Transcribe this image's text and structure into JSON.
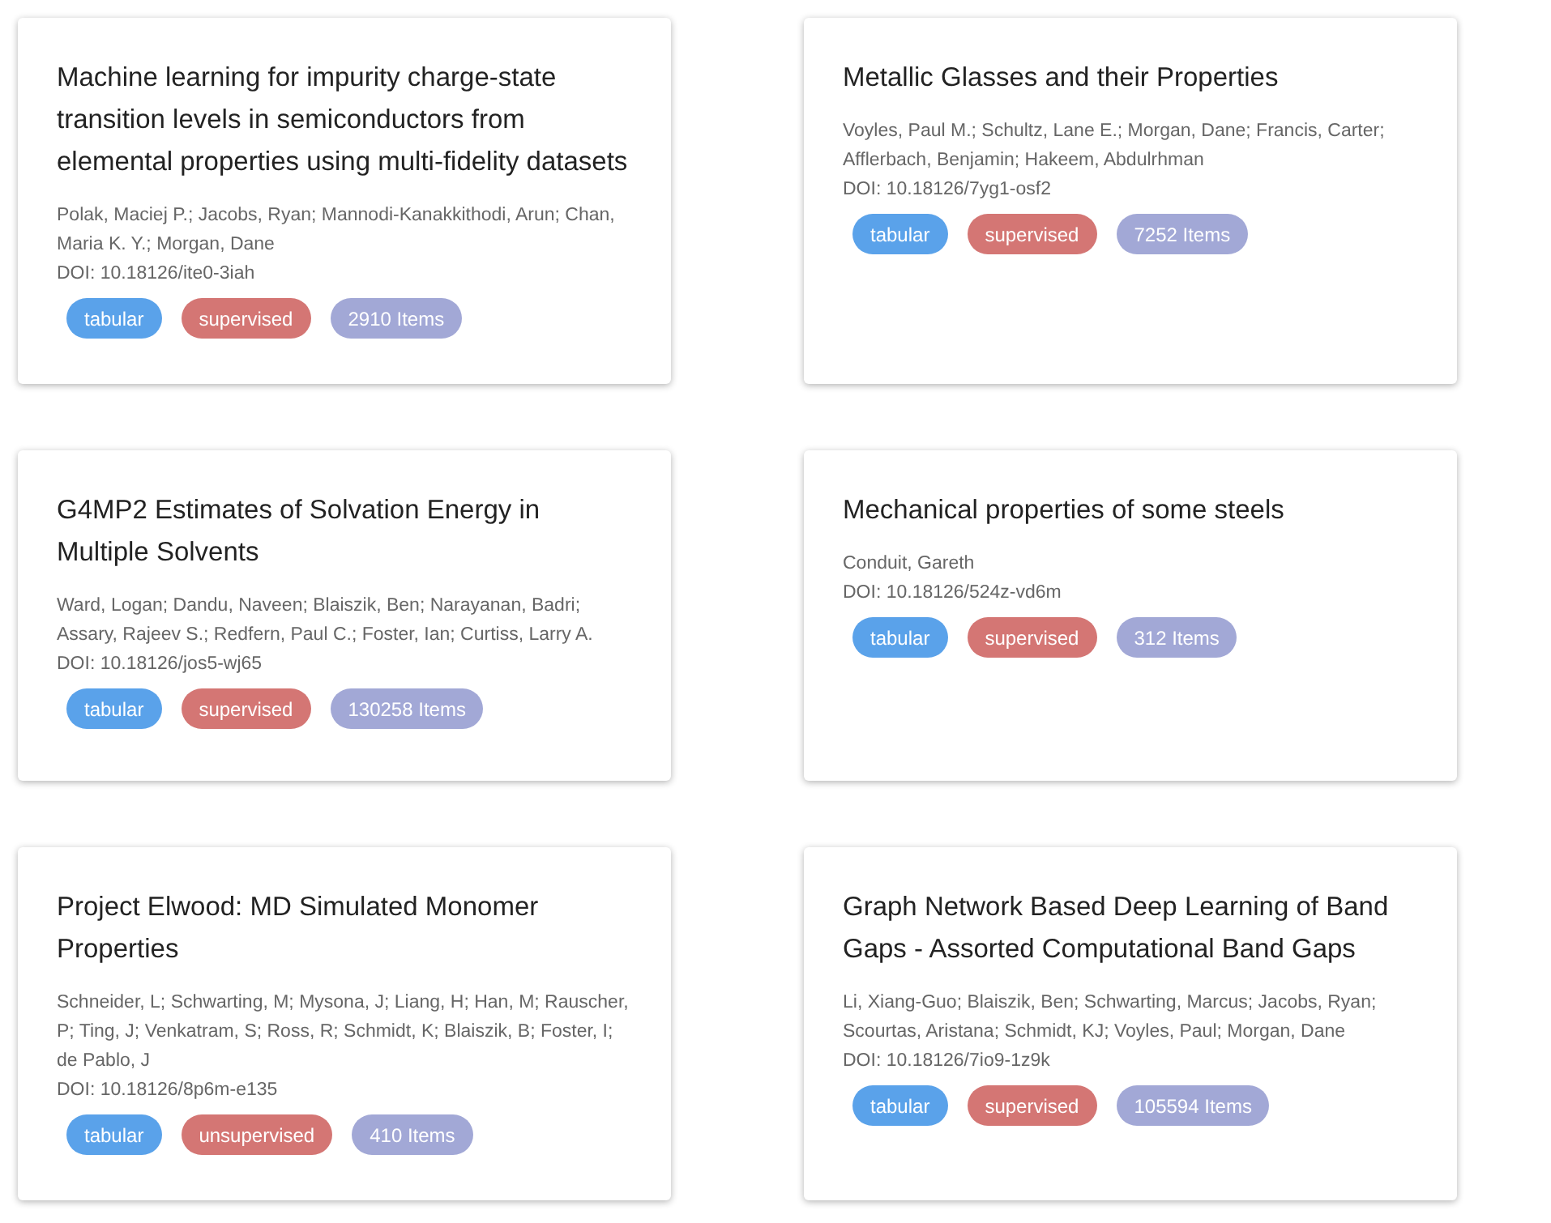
{
  "cards": [
    {
      "title": "Machine learning for impurity charge-state transition levels in semiconductors from elemental properties using multi-fidelity datasets",
      "authors": "Polak, Maciej P.; Jacobs, Ryan; Mannodi-Kanakkithodi, Arun; Chan, Maria K. Y.; Morgan, Dane",
      "doi": "DOI: 10.18126/ite0-3iah",
      "tags": [
        {
          "label": "tabular",
          "color": "#5aa2ea"
        },
        {
          "label": "supervised",
          "color": "#d47674"
        },
        {
          "label": "2910 Items",
          "color": "#a2a8d6"
        }
      ]
    },
    {
      "title": "Metallic Glasses and their Properties",
      "authors": "Voyles, Paul M.; Schultz, Lane E.; Morgan, Dane; Francis, Carter; Afflerbach, Benjamin; Hakeem, Abdulrhman",
      "doi": "DOI: 10.18126/7yg1-osf2",
      "tags": [
        {
          "label": "tabular",
          "color": "#5aa2ea"
        },
        {
          "label": "supervised",
          "color": "#d47674"
        },
        {
          "label": "7252 Items",
          "color": "#a2a8d6"
        }
      ]
    },
    {
      "title": "G4MP2 Estimates of Solvation Energy in Multiple Solvents",
      "authors": "Ward, Logan; Dandu, Naveen; Blaiszik, Ben; Narayanan, Badri; Assary, Rajeev S.; Redfern, Paul C.; Foster, Ian; Curtiss, Larry A.",
      "doi": "DOI: 10.18126/jos5-wj65",
      "tags": [
        {
          "label": "tabular",
          "color": "#5aa2ea"
        },
        {
          "label": "supervised",
          "color": "#d47674"
        },
        {
          "label": "130258 Items",
          "color": "#a2a8d6"
        }
      ]
    },
    {
      "title": "Mechanical properties of some steels",
      "authors": "Conduit, Gareth",
      "doi": "DOI: 10.18126/524z-vd6m",
      "tags": [
        {
          "label": "tabular",
          "color": "#5aa2ea"
        },
        {
          "label": "supervised",
          "color": "#d47674"
        },
        {
          "label": "312 Items",
          "color": "#a2a8d6"
        }
      ]
    },
    {
      "title": "Project Elwood: MD Simulated Monomer Properties",
      "authors": "Schneider, L; Schwarting, M; Mysona, J; Liang, H; Han, M; Rauscher, P; Ting, J; Venkatram, S; Ross, R; Schmidt, K; Blaiszik, B; Foster, I; de Pablo, J",
      "doi": "DOI: 10.18126/8p6m-e135",
      "tags": [
        {
          "label": "tabular",
          "color": "#5aa2ea"
        },
        {
          "label": "unsupervised",
          "color": "#d47674"
        },
        {
          "label": "410 Items",
          "color": "#a2a8d6"
        }
      ]
    },
    {
      "title": "Graph Network Based Deep Learning of Band Gaps - Assorted Computational Band Gaps",
      "authors": "Li, Xiang-Guo; Blaiszik, Ben; Schwarting, Marcus; Jacobs, Ryan; Scourtas, Aristana; Schmidt, KJ; Voyles, Paul; Morgan, Dane",
      "doi": "DOI: 10.18126/7io9-1z9k",
      "tags": [
        {
          "label": "tabular",
          "color": "#5aa2ea"
        },
        {
          "label": "supervised",
          "color": "#d47674"
        },
        {
          "label": "105594 Items",
          "color": "#a2a8d6"
        }
      ]
    }
  ]
}
